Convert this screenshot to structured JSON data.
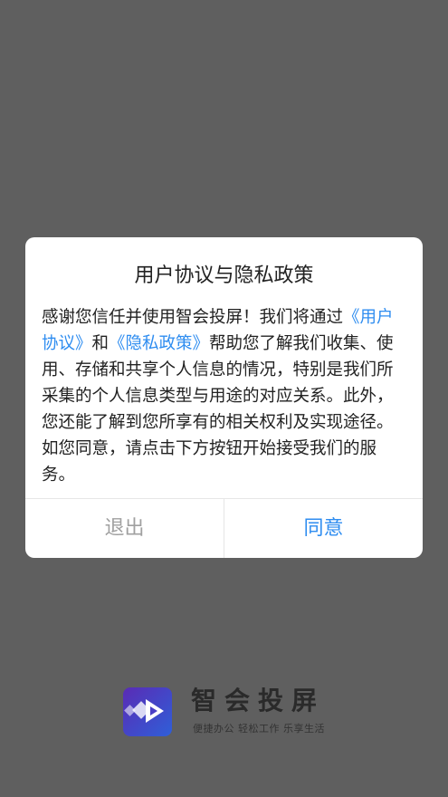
{
  "dialog": {
    "title": "用户协议与隐私政策",
    "body_intro": "感谢您信任并使用智会投屏！我们将通过",
    "user_agreement_link": "《用户协议》",
    "conjunction": "和",
    "privacy_policy_link": "《隐私政策》",
    "body_rest": "帮助您了解我们收集、使用、存储和共享个人信息的情况，特别是我们所采集的个人信息类型与用途的对应关系。此外，您还能了解到您所享有的相关权利及实现途径。如您同意，请点击下方按钮开始接受我们的服务。",
    "exit_label": "退出",
    "agree_label": "同意"
  },
  "brand": {
    "name": "智会投屏",
    "slogan": "便捷办公 轻松工作 乐享生活"
  },
  "colors": {
    "overlay": "#5f5f5f",
    "accent": "#2f8df0",
    "muted": "#a0a0a0"
  },
  "icons": {
    "logo": "play-logo-icon"
  }
}
